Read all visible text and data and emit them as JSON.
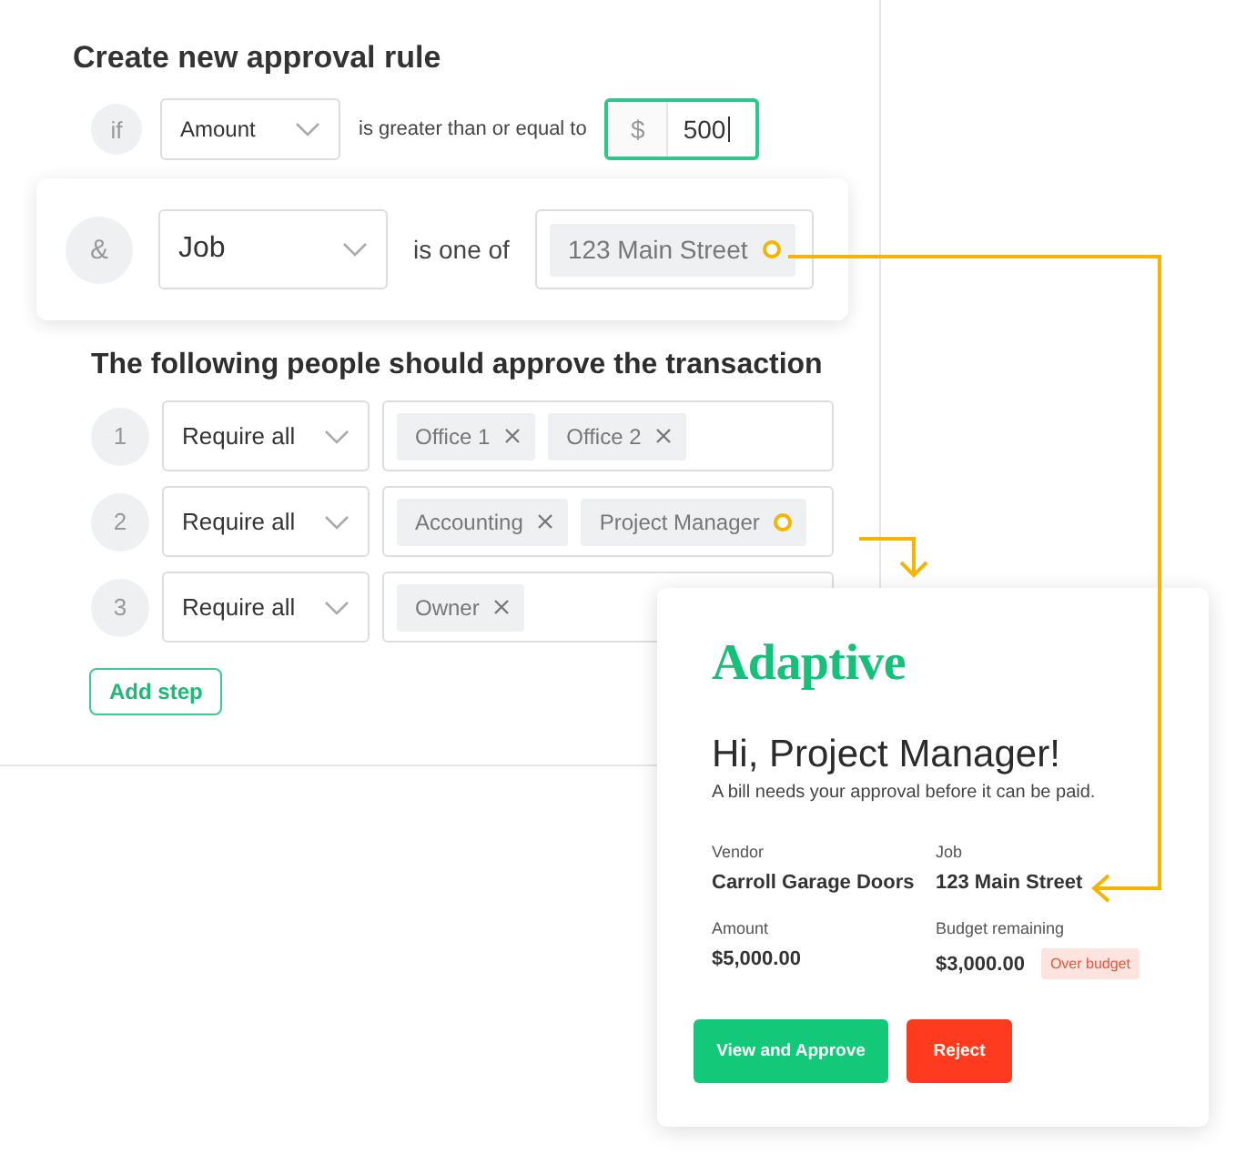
{
  "title": "Create new approval rule",
  "condition": {
    "prefix": "if",
    "field": "Amount",
    "operator": "is greater than or equal to",
    "currency": "$",
    "value": "500"
  },
  "and_condition": {
    "prefix": "&",
    "field": "Job",
    "operator": "is one of",
    "values": [
      {
        "label": "123 Main Street",
        "removable": false
      }
    ]
  },
  "approvers_heading": "The following people should approve the transaction",
  "steps": [
    {
      "number": "1",
      "mode": "Require all",
      "approvers": [
        {
          "label": "Office 1",
          "removable": true
        },
        {
          "label": "Office 2",
          "removable": true
        }
      ]
    },
    {
      "number": "2",
      "mode": "Require all",
      "approvers": [
        {
          "label": "Accounting",
          "removable": true
        },
        {
          "label": "Project Manager",
          "removable": false
        }
      ]
    },
    {
      "number": "3",
      "mode": "Require all",
      "approvers": [
        {
          "label": "Owner",
          "removable": true
        }
      ]
    }
  ],
  "add_step": "Add step",
  "email": {
    "logo": "Adaptive",
    "greeting": "Hi, Project Manager!",
    "message": "A bill needs your approval before it can be paid.",
    "fields": [
      {
        "label": "Vendor",
        "value": "Carroll Garage Doors"
      },
      {
        "label": "Job",
        "value": "123 Main Street"
      },
      {
        "label": "Amount",
        "value": "$5,000.00"
      },
      {
        "label": "Budget remaining",
        "value": "$3,000.00",
        "badge": "Over budget"
      }
    ],
    "buttons": [
      {
        "label": "View and Approve",
        "kind": "primary"
      },
      {
        "label": "Reject",
        "kind": "danger"
      }
    ]
  }
}
